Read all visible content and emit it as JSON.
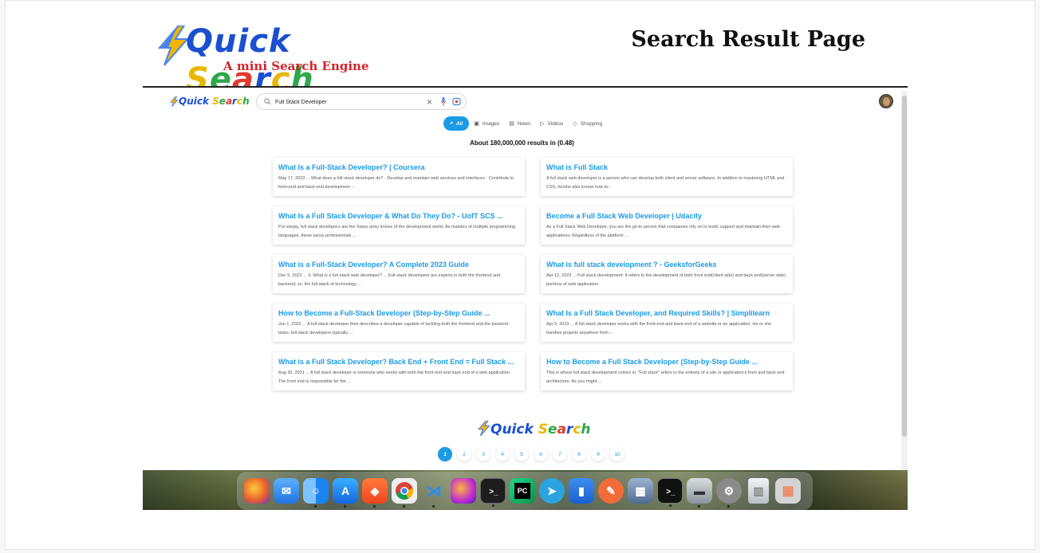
{
  "banner": {
    "brand_word_1": "Quick",
    "brand_word_2": "Search",
    "tagline": "A mini Search Engine",
    "page_heading": "Search Result Page"
  },
  "browser": {
    "logo_word_1": "Quick",
    "logo_word_2": "Search",
    "search": {
      "value": "Full Stack Developer",
      "placeholder": ""
    },
    "clear_glyph": "×",
    "tabs": [
      {
        "label": "All",
        "icon": "search-icon",
        "active": true
      },
      {
        "label": "Images",
        "icon": "image-icon",
        "active": false
      },
      {
        "label": "News",
        "icon": "news-icon",
        "active": false
      },
      {
        "label": "Videos",
        "icon": "video-icon",
        "active": false
      },
      {
        "label": "Shopping",
        "icon": "tag-icon",
        "active": false
      }
    ],
    "result_count": "About 180,000,000 results in (0.48)",
    "results": [
      {
        "title": "What Is a Full-Stack Developer? | Coursera",
        "snippet": "May 17, 2023 ... What does a full-stack developer do? · Develop and maintain web services and interfaces · Contribute to front-end and back-end development ..."
      },
      {
        "title": "What is Full Stack",
        "snippet": "A full stack web developer is a person who can develop both client and server software. In addition to mastering HTML and CSS, he/she also knows how to:."
      },
      {
        "title": "What Is a Full Stack Developer & What Do They Do? - UofT SCS ...",
        "snippet": "Put simply, full stack developers are the Swiss army knives of the development world. As masters of multiple programming languages, these savvy professionals ..."
      },
      {
        "title": "Become a Full Stack Web Developer | Udacity",
        "snippet": "As a Full Stack Web Developer, you are the go-to person that companies rely on to build, support and maintain their web applications. Regardless of the platform ..."
      },
      {
        "title": "What is a Full-Stack Developer? A Complete 2023 Guide",
        "snippet": "Dec 5, 2022 ... 3. What is a full-stack web developer? ... Full-stack developers are experts in both the frontend and backend; so, the full-stack of technology ..."
      },
      {
        "title": "What is full stack development ? - GeeksforGeeks",
        "snippet": "Apr 12, 2023 ... Full stack development: It refers to the development of both front end(client side) and back end(server side) portions of web application."
      },
      {
        "title": "How to Become a Full-Stack Developer (Step-by-Step Guide ...",
        "snippet": "Jun 1, 2022 ... A full-stack developer then describes a developer capable of tackling both the frontend and the backend tasks. full-stack developers typically ..."
      },
      {
        "title": "What Is a Full Stack Developer, and Required Skills? | Simplilearn",
        "snippet": "Apr 5, 2023 ... A full stack developer works with the front-end and back-end of a website or an application. He or she handles projects anywhere from ..."
      },
      {
        "title": "What is a Full Stack Developer? Back End + Front End = Full Stack ...",
        "snippet": "Aug 30, 2021 ... A full stack developer is someone who works with both the front end and back end of a web application. The front end is responsible for the ..."
      },
      {
        "title": "How to Become a Full Stack Developer (Step-by-Step Guide ...",
        "snippet": "This is where full stack development comes in. \"Full stack\" refers to the entirety of a site or application's front and back end architecture. As you might ..."
      }
    ],
    "footer_logo_word_1": "Quick",
    "footer_logo_word_2": "Search",
    "pages": [
      "1",
      "2",
      "3",
      "4",
      "5",
      "6",
      "7",
      "8",
      "9",
      "10"
    ],
    "current_page": "1"
  },
  "dock": {
    "apps": [
      {
        "name": "firefox-icon",
        "color": "#e8632b"
      },
      {
        "name": "mail-icon",
        "color": "#2f8ef0"
      },
      {
        "name": "finder-icon",
        "color": "#3b9df0"
      },
      {
        "name": "app-store-icon",
        "color": "#1f7ef0"
      },
      {
        "name": "brave-icon",
        "color": "#f25a25"
      },
      {
        "name": "chrome-icon",
        "color": "#e7e7e7"
      },
      {
        "name": "vscode-icon",
        "color": "#2a5d98"
      },
      {
        "name": "firefox-dev-icon",
        "color": "#6c33c9"
      },
      {
        "name": "terminal-icon",
        "color": "#1d1d1d"
      },
      {
        "name": "pycharm-icon",
        "color": "#21b35d"
      },
      {
        "name": "telegram-icon",
        "color": "#2aa3de"
      },
      {
        "name": "books-icon",
        "color": "#1f7ae0"
      },
      {
        "name": "postman-icon",
        "color": "#f26b3a"
      },
      {
        "name": "preview-icon",
        "color": "#6a86a8"
      },
      {
        "name": "iterm-icon",
        "color": "#1b1b1b"
      },
      {
        "name": "disk-utility-icon",
        "color": "#9aa3ad"
      },
      {
        "name": "system-settings-icon",
        "color": "#7d7d7d"
      },
      {
        "name": "trash-icon",
        "color": "#d9dde2"
      },
      {
        "name": "launchpad-icon",
        "color": "#c8c8c8"
      }
    ]
  },
  "colors": {
    "accent": "#1a9be6",
    "brand_q": "#1a9be6",
    "brand_heading_red": "#d0242b"
  }
}
